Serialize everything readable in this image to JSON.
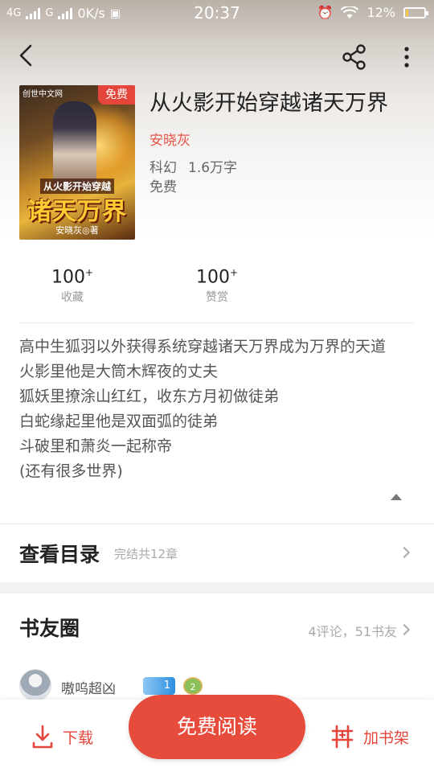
{
  "status_bar": {
    "network_left": "4G",
    "network_right": "G",
    "speed": "0K/s",
    "time": "20:37",
    "battery": "12%",
    "battery_level": 0.12
  },
  "book": {
    "title": "从火影开始穿越诸天万界",
    "author": "安晓灰",
    "genre": "科幻",
    "word_count": "1.6万字",
    "price_label": "免费",
    "cover": {
      "badge": "免费",
      "subtitle": "从火影开始穿越",
      "big_text": "诸天万界",
      "author_line": "安晓灰◎著",
      "publisher_mark": "创世中文网"
    }
  },
  "stats": [
    {
      "value": "100",
      "suffix": "+",
      "label": "收藏"
    },
    {
      "value": "100",
      "suffix": "+",
      "label": "赞赏"
    }
  ],
  "description": [
    "高中生狐羽以外获得系统穿越诸天万界成为万界的天道",
    "火影里他是大筒木辉夜的丈夫",
    "狐妖里撩涂山红红，收东方月初做徒弟",
    "白蛇缘起里他是双面弧的徒弟",
    "斗破里和萧炎一起称帝",
    "(还有很多世界)"
  ],
  "toc": {
    "title": "查看目录",
    "summary": "完结共12章"
  },
  "circle": {
    "title": "书友圈",
    "summary": "4评论，51书友"
  },
  "comment": {
    "username": "嗷呜超凶",
    "level": "1",
    "medal": "2"
  },
  "bottom": {
    "download": "下载",
    "read": "免费阅读",
    "add_shelf": "加书架"
  },
  "colors": {
    "accent": "#e5453a",
    "read_button": "#e64b3c"
  }
}
